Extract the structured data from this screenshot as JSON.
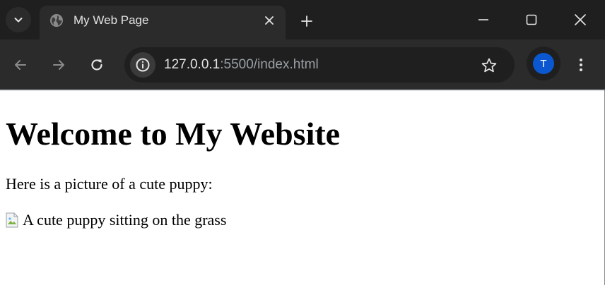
{
  "browser": {
    "tab": {
      "title": "My Web Page",
      "favicon": "globe-icon"
    },
    "address_bar": {
      "url_host": "127.0.0.1",
      "url_rest": ":5500/index.html"
    },
    "profile": {
      "initial": "T",
      "color": "#0b57d0"
    },
    "icons": {
      "tab_search": "chevron-down-icon",
      "tab_close": "close-icon",
      "new_tab": "plus-icon",
      "minimize": "minimize-icon",
      "maximize": "maximize-icon",
      "window_close": "close-icon",
      "back": "arrow-left-icon",
      "forward": "arrow-right-icon",
      "reload": "reload-icon",
      "site_info": "info-icon",
      "bookmark": "star-icon",
      "menu": "more-vert-icon"
    },
    "colors": {
      "tabstrip": "#1f1f1f",
      "toolbar": "#2b2b2b",
      "omnibox": "#1f1f1f"
    }
  },
  "page": {
    "heading": "Welcome to My Website",
    "paragraph": "Here is a picture of a cute puppy:",
    "image_alt": "A cute puppy sitting on the grass",
    "background": "#ffffff"
  }
}
